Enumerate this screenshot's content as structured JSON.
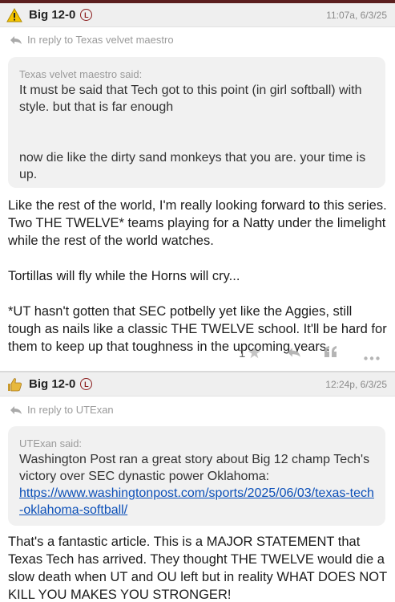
{
  "posts": [
    {
      "username": "Big 12-0",
      "badge": "L",
      "avatar_icon": "warning-icon",
      "timestamp": "11:07a, 6/3/25",
      "reply_to": "In reply to Texas velvet maestro",
      "quote": {
        "author": "Texas velvet maestro said:",
        "paragraph1": "It must be said that Tech got to this point (in girl softball) with style. but that is far enough",
        "paragraph2": "now die like the dirty sand monkeys that you are. your time is up."
      },
      "body": {
        "paragraph1": "Like the rest of the world, I'm really looking forward to this series. Two THE TWELVE* teams playing for a Natty under the limelight while the rest of the world watches.",
        "paragraph2": "Tortillas will fly while the Horns will cry...",
        "paragraph3": "*UT hasn't gotten that SEC potbelly yet like the Aggies, still tough as nails like a classic THE TWELVE school. It'll be hard for them to keep up that toughness in the upcoming years."
      },
      "star_count": "1"
    },
    {
      "username": "Big 12-0",
      "badge": "L",
      "avatar_icon": "thumbs-up-icon",
      "timestamp": "12:24p, 6/3/25",
      "reply_to": "In reply to UTExan",
      "quote": {
        "author": "UTExan said:",
        "text": "Washington Post ran a great story about Big 12 champ Tech's victory over SEC dynastic power Oklahoma:",
        "link": "https://www.washingtonpost.com/sports/2025/06/03/texas-tech-oklahoma-softball/"
      },
      "body": {
        "paragraph1": "That's a fantastic article. This is a MAJOR STATEMENT that Texas Tech has arrived. They thought THE TWELVE would die a slow death when UT and OU left but in reality WHAT DOES NOT KILL YOU MAKES YOU STRONGER!"
      }
    }
  ],
  "colors": {
    "header_bg": "#efefef",
    "quote_bg": "#f1f1f1",
    "link": "#0b4fb8",
    "badge": "#8a1c1c",
    "top_bar": "#5b1f1f"
  }
}
